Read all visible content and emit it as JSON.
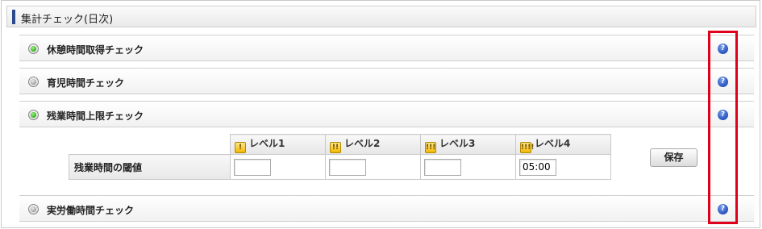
{
  "header": {
    "title": "集計チェック(日次)"
  },
  "sections": [
    {
      "label": "休憩時間取得チェック",
      "selected": true,
      "help_icon": "question-circle-icon"
    },
    {
      "label": "育児時間チェック",
      "selected": false,
      "help_icon": "question-circle-icon"
    },
    {
      "label": "残業時間上限チェック",
      "selected": true,
      "help_icon": "question-circle-icon"
    },
    {
      "label": "実労働時間チェック",
      "selected": false,
      "help_icon": "question-circle-icon"
    }
  ],
  "threshold_table": {
    "row_header": "残業時間の閾値",
    "levels": [
      {
        "label": "レベル1",
        "icon_glyph": "!",
        "value": ""
      },
      {
        "label": "レベル2",
        "icon_glyph": "!!",
        "value": ""
      },
      {
        "label": "レベル3",
        "icon_glyph": "!!!",
        "value": ""
      },
      {
        "label": "レベル4",
        "icon_glyph": "!!!!",
        "value": "05:00"
      }
    ]
  },
  "save_button": {
    "label": "保存"
  },
  "help_glyph": "?",
  "colors": {
    "accent_bar": "#2a4a8a",
    "radio_selected": "#3fbf2a",
    "help_icon": "#2f5bc4",
    "highlight_box": "#e0001b",
    "level_icon": "#f2b800"
  }
}
